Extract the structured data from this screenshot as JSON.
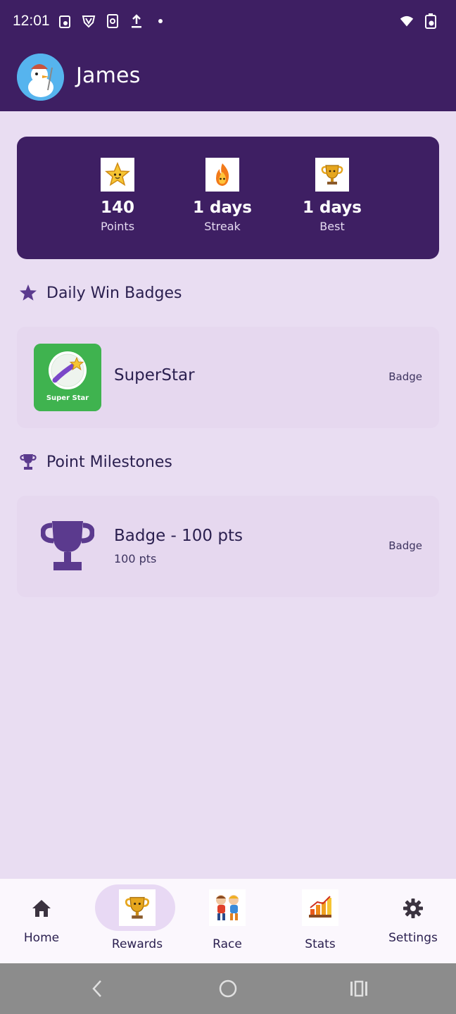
{
  "status_bar": {
    "time": "12:01"
  },
  "header": {
    "user_name": "James"
  },
  "summary": {
    "points": {
      "value": "140",
      "label": "Points",
      "icon": "star-face-icon"
    },
    "streak": {
      "value": "1 days",
      "label": "Streak",
      "icon": "flame-face-icon"
    },
    "best": {
      "value": "1 days",
      "label": "Best",
      "icon": "trophy-face-icon"
    }
  },
  "sections": {
    "daily_badges": {
      "title": "Daily Win Badges",
      "items": [
        {
          "title": "SuperStar",
          "tag": "Badge",
          "image_caption": "Super Star"
        }
      ]
    },
    "milestones": {
      "title": "Point Milestones",
      "items": [
        {
          "title": "Badge - 100 pts",
          "subtitle": "100 pts",
          "tag": "Badge"
        }
      ]
    }
  },
  "bottom_nav": {
    "items": [
      {
        "label": "Home",
        "icon": "home-icon"
      },
      {
        "label": "Rewards",
        "icon": "trophy-icon",
        "active": true
      },
      {
        "label": "Race",
        "icon": "race-kids-icon"
      },
      {
        "label": "Stats",
        "icon": "bar-chart-icon"
      },
      {
        "label": "Settings",
        "icon": "gear-icon"
      }
    ]
  },
  "colors": {
    "primary_dark": "#3e1f63",
    "background": "#e9ddf2",
    "accent_purple": "#5b3a8e",
    "badge_green": "#3fb34f"
  }
}
